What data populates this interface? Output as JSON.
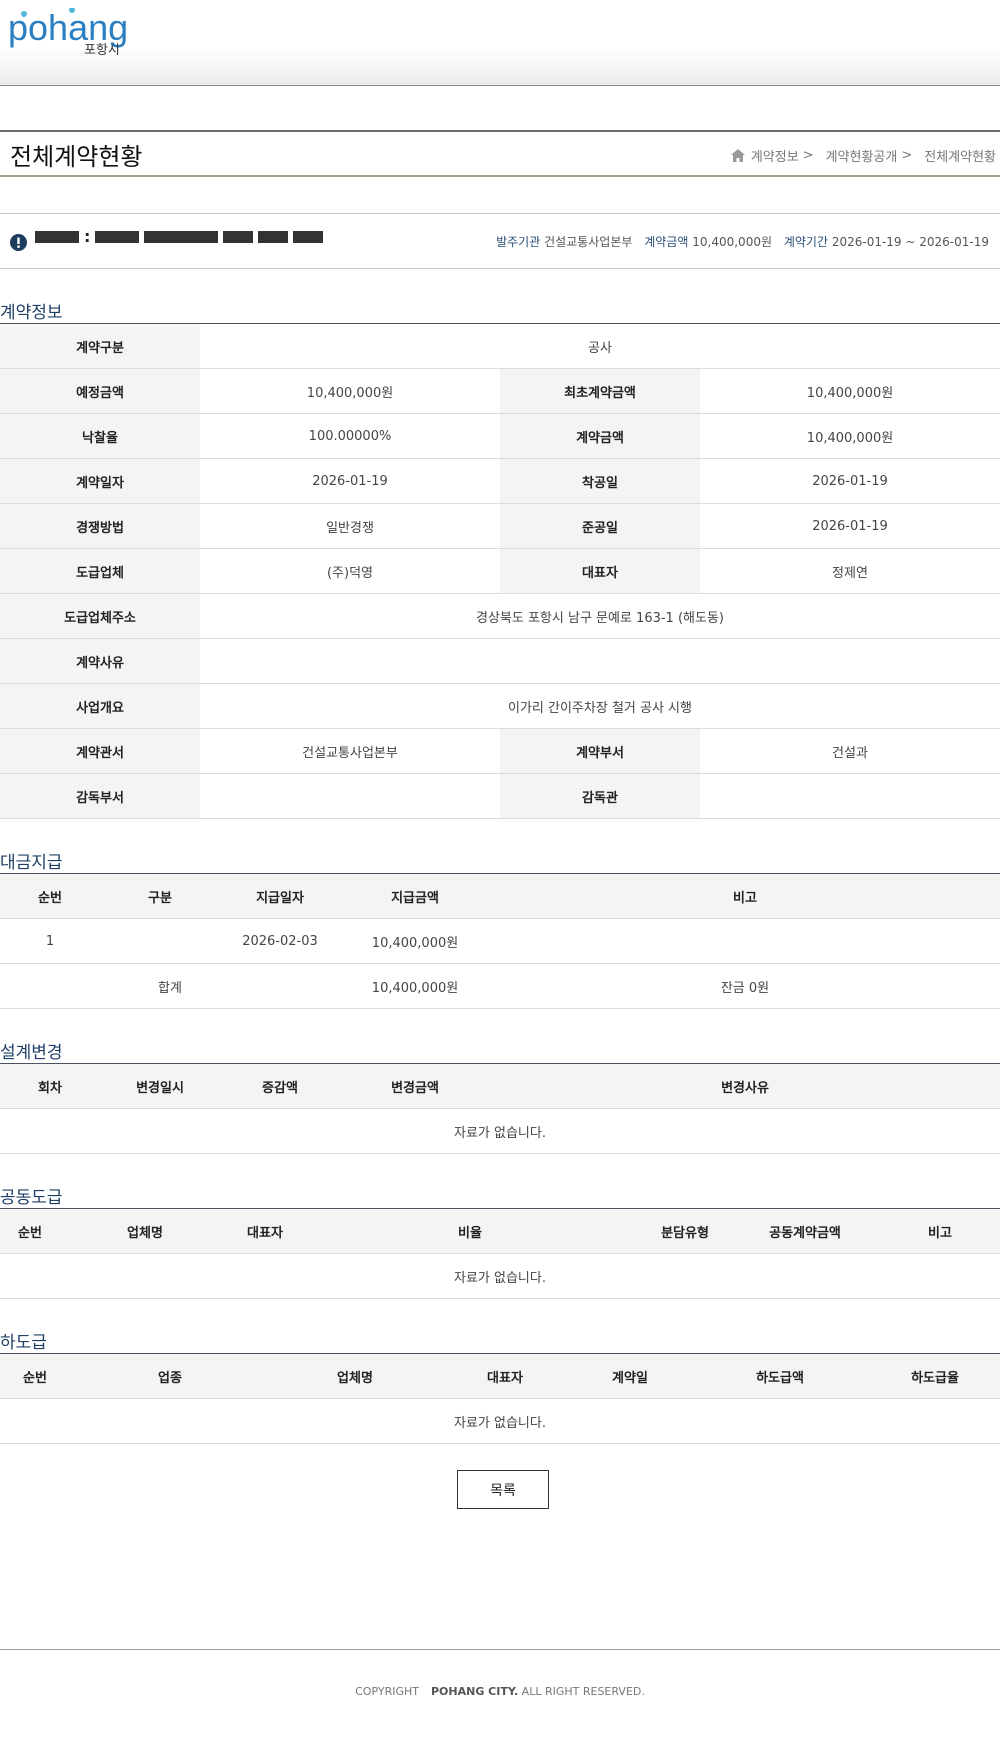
{
  "header": {
    "logo_text": "pohang",
    "logo_sub": "포항시"
  },
  "title_bar": {
    "title": "전체계약현황",
    "breadcrumb": [
      "계약정보",
      "계약현황공개",
      "전체계약현황"
    ],
    "sep": ">"
  },
  "info_bar": {
    "colon": ":",
    "summary": [
      {
        "key": "발주기관",
        "value": "건설교통사업본부"
      },
      {
        "key": "계약금액",
        "value": "10,400,000원"
      },
      {
        "key": "계약기간",
        "value": "2026-01-19 ~ 2026-01-19"
      }
    ]
  },
  "contract": {
    "section_title": "계약정보",
    "rows": [
      {
        "label1": "계약구분",
        "value1": "공사",
        "span": true
      },
      {
        "label1": "예정금액",
        "value1": "10,400,000원",
        "label2": "최초계약금액",
        "value2": "10,400,000원"
      },
      {
        "label1": "낙찰율",
        "value1": "100.00000%",
        "label2": "계약금액",
        "value2": "10,400,000원"
      },
      {
        "label1": "계약일자",
        "value1": "2026-01-19",
        "label2": "착공일",
        "value2": "2026-01-19"
      },
      {
        "label1": "경쟁방법",
        "value1": "일반경쟁",
        "label2": "준공일",
        "value2": "2026-01-19"
      },
      {
        "label1": "도급업체",
        "value1": "(주)덕영",
        "label2": "대표자",
        "value2": "정제연"
      },
      {
        "label1": "도급업체주소",
        "value1": "경상북도 포항시 남구 문예로 163-1 (해도동)",
        "span": true
      },
      {
        "label1": "계약사유",
        "value1": "",
        "span": true
      },
      {
        "label1": "사업개요",
        "value1": "이가리 간이주차장 철거 공사 시행",
        "span": true
      },
      {
        "label1": "계약관서",
        "value1": "건설교통사업본부",
        "label2": "계약부서",
        "value2": "건설과"
      },
      {
        "label1": "감독부서",
        "value1": "",
        "label2": "감독관",
        "value2": ""
      }
    ]
  },
  "payment": {
    "section_title": "대금지급",
    "headers": [
      "순번",
      "구분",
      "지급일자",
      "지급금액",
      "비고"
    ],
    "rows": [
      {
        "no": "1",
        "type": "",
        "date": "2026-02-03",
        "amount": "10,400,000원",
        "note": ""
      }
    ],
    "total": {
      "label": "합계",
      "amount": "10,400,000원",
      "note": "잔금 0원"
    }
  },
  "design_change": {
    "section_title": "설계변경",
    "headers": [
      "회차",
      "변경일시",
      "증감액",
      "변경금액",
      "변경사유"
    ],
    "empty": "자료가 없습니다."
  },
  "joint": {
    "section_title": "공동도급",
    "headers": [
      "순번",
      "업체명",
      "대표자",
      "비율",
      "분담유형",
      "공동계약금액",
      "비고"
    ],
    "empty": "자료가 없습니다."
  },
  "subcontract": {
    "section_title": "하도급",
    "headers": [
      "순번",
      "업종",
      "업체명",
      "대표자",
      "계약일",
      "하도급액",
      "하도급율"
    ],
    "empty": "자료가 없습니다."
  },
  "buttons": {
    "list_label": "목록"
  },
  "footer": {
    "copyright": "COPYRIGHT",
    "brand": "POHANG CITY.",
    "rights": " ALL RIGHT RESERVED."
  }
}
